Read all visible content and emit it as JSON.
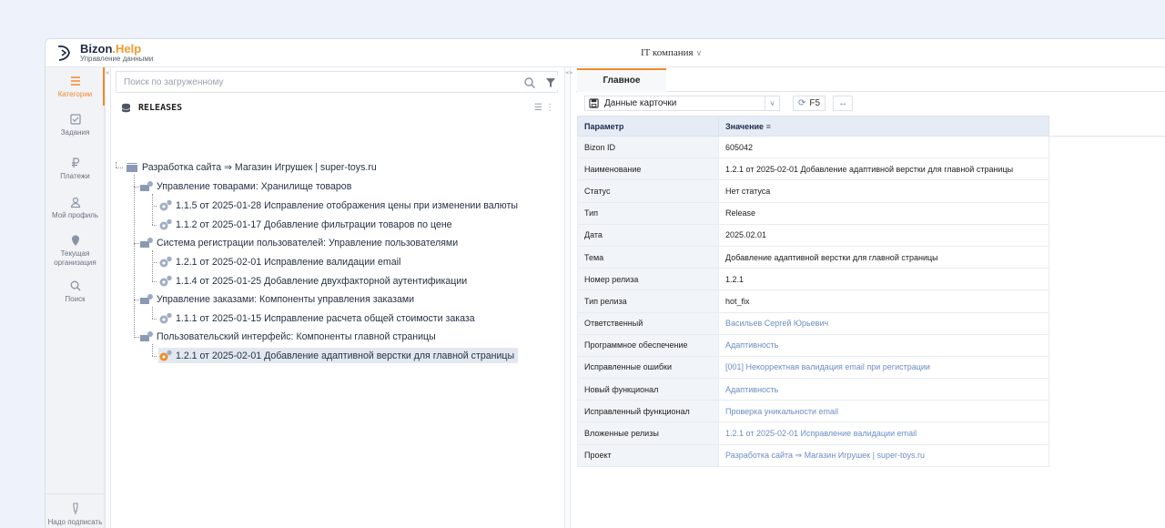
{
  "header": {
    "logo_name_main": "Bizon",
    "logo_name_accent": ".Help",
    "logo_subtitle": "Управление данными",
    "company": "IT компания",
    "company_chevron": "∨"
  },
  "sidebar": {
    "items": [
      {
        "label": "Категории",
        "icon": "hamburger-icon"
      },
      {
        "label": "Задания",
        "icon": "checkbox-icon"
      },
      {
        "label": "Платежи",
        "icon": "ruble-icon"
      },
      {
        "label": "Мой профиль",
        "icon": "user-icon"
      },
      {
        "label": "Текущая организация",
        "icon": "location-pin-icon"
      },
      {
        "label": "Поиск",
        "icon": "search-icon"
      },
      {
        "label": "Надо подписать",
        "icon": "pen-icon"
      }
    ]
  },
  "tree": {
    "search_placeholder": "Поиск по загруженному",
    "title": "RELEASES",
    "nodes": [
      {
        "label": "Разработка сайта ⇒ Магазин Игрушек | super-toys.ru",
        "type": "project"
      },
      {
        "label": "Управление товарами: Хранилище товаров",
        "type": "group"
      },
      {
        "label": "1.1.5 от 2025-01-28 Исправление отображения цены при изменении валюты",
        "type": "release"
      },
      {
        "label": "1.1.2 от 2025-01-17 Добавление фильтрации товаров по цене",
        "type": "release"
      },
      {
        "label": "Система регистрации пользователей: Управление пользователями",
        "type": "group"
      },
      {
        "label": "1.2.1 от 2025-02-01 Исправление валидации email",
        "type": "release"
      },
      {
        "label": "1.1.4 от 2025-01-25 Добавление двухфакторной аутентификации",
        "type": "release"
      },
      {
        "label": "Управление заказами: Компоненты управления заказами",
        "type": "group"
      },
      {
        "label": "1.1.1 от 2025-01-15 Исправление расчета общей стоимости заказа",
        "type": "release"
      },
      {
        "label": "Пользовательский интерфейс: Компоненты главной страницы",
        "type": "group"
      },
      {
        "label": "1.2.1 от 2025-02-01 Добавление адаптивной верстки для главной страницы",
        "type": "release",
        "selected": true
      }
    ]
  },
  "card": {
    "tab": "Главное",
    "select_value": "Данные карточки",
    "refresh_label": "F5",
    "columns": {
      "param": "Параметр",
      "value": "Значение"
    },
    "rows": [
      {
        "param": "Bizon ID",
        "value": "605042",
        "link": false
      },
      {
        "param": "Наименование",
        "value": "1.2.1 от 2025-02-01 Добавление адаптивной верстки для главной страницы",
        "link": false
      },
      {
        "param": "Статус",
        "value": "Нет статуса",
        "link": false
      },
      {
        "param": "Тип",
        "value": "Release",
        "link": false
      },
      {
        "param": "Дата",
        "value": "2025.02.01",
        "link": false
      },
      {
        "param": "Тема",
        "value": "Добавление адаптивной верстки для главной страницы",
        "link": false
      },
      {
        "param": "Номер релиза",
        "value": "1.2.1",
        "link": false
      },
      {
        "param": "Тип релиза",
        "value": "hot_fix",
        "link": false
      },
      {
        "param": "Ответственный",
        "value": "Васильев Сергей Юрьевич",
        "link": true
      },
      {
        "param": "Программное обеспечение",
        "value": "Адаптивность",
        "link": true
      },
      {
        "param": "Исправленные ошибки",
        "value": "[001] Некорректная валидация email при регистрации",
        "link": true
      },
      {
        "param": "Новый функционал",
        "value": "Адаптивность",
        "link": true
      },
      {
        "param": "Исправленный функционал",
        "value": "Проверка уникальности email",
        "link": true
      },
      {
        "param": "Вложенные релизы",
        "value": "1.2.1 от 2025-02-01 Исправление валидации email",
        "link": true
      },
      {
        "param": "Проект",
        "value": "Разработка сайта ⇒ Магазин Игрушек | super-toys.ru",
        "link": true
      }
    ]
  },
  "colors": {
    "accent": "#f08a2a",
    "link": "#6b8dc4",
    "header_bg": "#e5ecf6"
  }
}
